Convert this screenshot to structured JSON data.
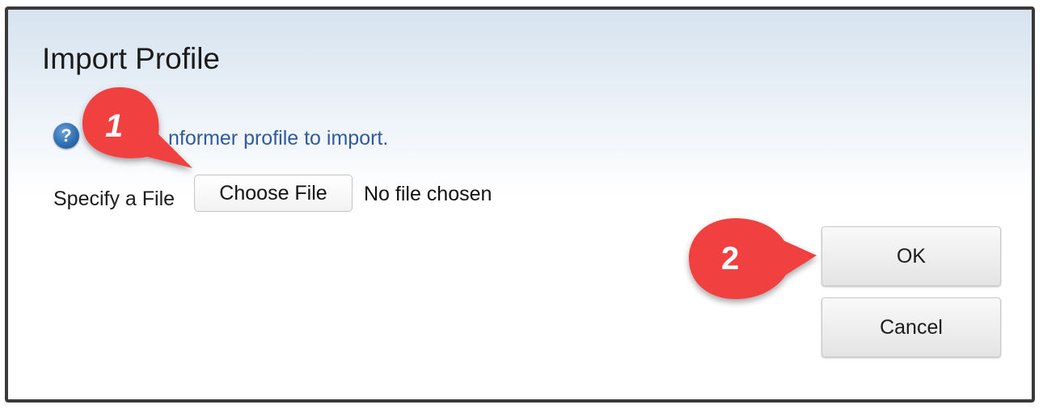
{
  "dialog": {
    "title": "Import Profile",
    "help_text": "nformer profile to import.",
    "file_label": "Specify a File",
    "choose_file_label": "Choose File",
    "no_file_text": "No file chosen",
    "help_icon": "question-mark-icon"
  },
  "buttons": {
    "ok_label": "OK",
    "cancel_label": "Cancel"
  },
  "callouts": [
    {
      "label": "1",
      "color": "#f0413f"
    },
    {
      "label": "2",
      "color": "#f0413f"
    }
  ],
  "colors": {
    "callout": "#f0413f",
    "link_text": "#2f5aa0",
    "border": "#3a3a3a"
  }
}
